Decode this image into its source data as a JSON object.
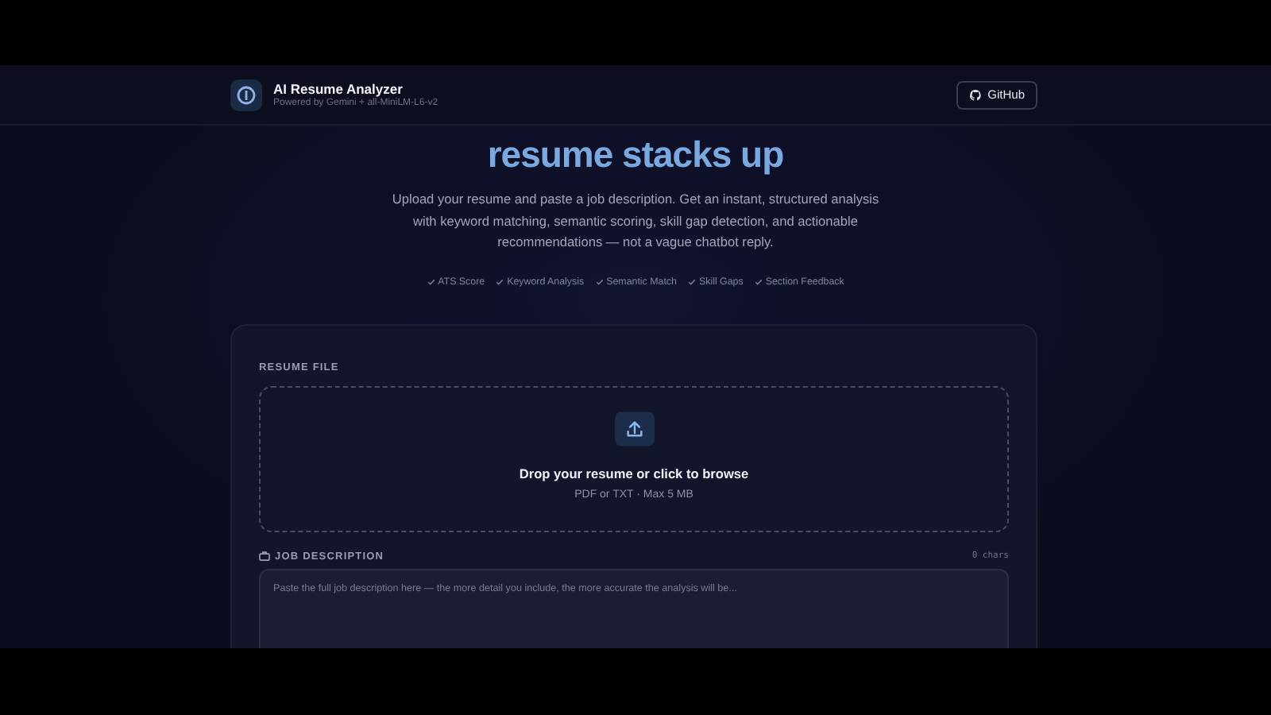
{
  "header": {
    "title": "AI Resume Analyzer",
    "subtitle": "Powered by Gemini + all-MiniLM-L6-v2",
    "github_button": "GitHub"
  },
  "hero": {
    "headline": "resume stacks up",
    "description": "Upload your resume and paste a job description. Get an instant, structured analysis with keyword matching, semantic scoring, skill gap detection, and actionable recommendations — not a vague chatbot reply.",
    "features": [
      "ATS Score",
      "Keyword Analysis",
      "Semantic Match",
      "Skill Gaps",
      "Section Feedback"
    ]
  },
  "form": {
    "resume_label": "RESUME FILE",
    "dropzone_title": "Drop your resume or click to browse",
    "dropzone_hint": "PDF or TXT · Max 5 MB",
    "job_label": "JOB DESCRIPTION",
    "char_count": "0 chars",
    "job_placeholder": "Paste the full job description here — the more detail you include, the more accurate the analysis will be..."
  }
}
